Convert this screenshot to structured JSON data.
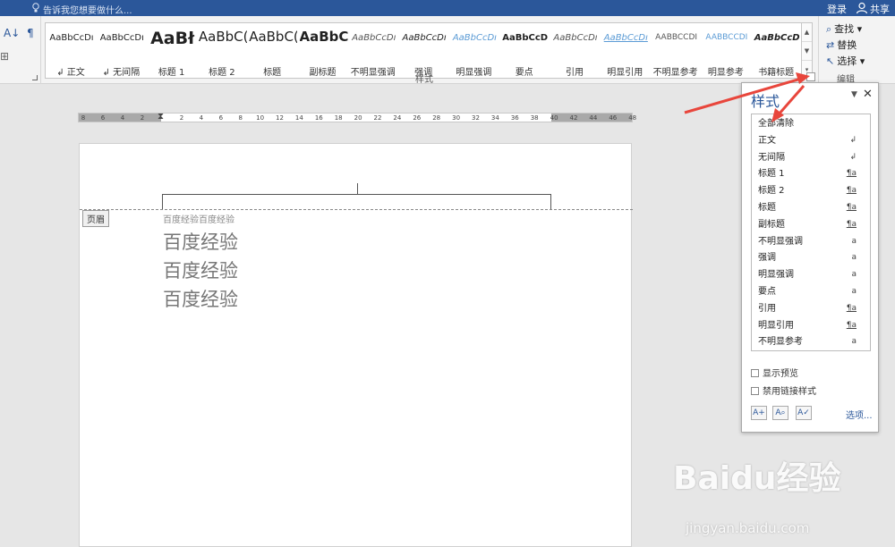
{
  "topbar": {
    "tell_me": "告诉我您想要做什么...",
    "login": "登录",
    "share": "共享"
  },
  "ribbon": {
    "styles_group_label": "样式",
    "editing_group_label": "编辑",
    "find": "查找",
    "replace": "替换",
    "select": "选择",
    "styles": [
      {
        "preview": "AaBbCcDı",
        "name": "↲ 正文"
      },
      {
        "preview": "AaBbCcDı",
        "name": "↲ 无间隔"
      },
      {
        "preview": "AaBł",
        "name": "标题 1"
      },
      {
        "preview": "AaBbC(",
        "name": "标题 2"
      },
      {
        "preview": "AaBbC(",
        "name": "标题"
      },
      {
        "preview": "AaBbC(",
        "name": "副标题"
      },
      {
        "preview": "AaBbCcDı",
        "name": "不明显强调"
      },
      {
        "preview": "AaBbCcDı",
        "name": "强调"
      },
      {
        "preview": "AaBbCcDı",
        "name": "明显强调"
      },
      {
        "preview": "AaBbCcD",
        "name": "要点"
      },
      {
        "preview": "AaBbCcDı",
        "name": "引用"
      },
      {
        "preview": "AaBbCcDı",
        "name": "明显引用"
      },
      {
        "preview": "AABBCCDI",
        "name": "不明显参考"
      },
      {
        "preview": "AABBCCDI",
        "name": "明显参考"
      },
      {
        "preview": "AaBbCcD",
        "name": "书籍标题"
      }
    ]
  },
  "ruler": {
    "ticks": [
      "8",
      "6",
      "4",
      "2",
      "2",
      "4",
      "6",
      "8",
      "10",
      "12",
      "14",
      "16",
      "18",
      "20",
      "22",
      "24",
      "26",
      "28",
      "30",
      "32",
      "34",
      "36",
      "38",
      "40",
      "42",
      "44",
      "46",
      "48"
    ]
  },
  "document": {
    "header_tag": "页眉",
    "header_text": "百度经验百度经验",
    "lines": [
      "百度经验",
      "百度经验",
      "百度经验"
    ]
  },
  "pane": {
    "title": "样式",
    "items": [
      {
        "label": "全部清除",
        "indicator": ""
      },
      {
        "label": "正文",
        "indicator": "↲"
      },
      {
        "label": "无间隔",
        "indicator": "↲"
      },
      {
        "label": "标题 1",
        "indicator": "¶a"
      },
      {
        "label": "标题 2",
        "indicator": "¶a"
      },
      {
        "label": "标题",
        "indicator": "¶a"
      },
      {
        "label": "副标题",
        "indicator": "¶a"
      },
      {
        "label": "不明显强调",
        "indicator": "a"
      },
      {
        "label": "强调",
        "indicator": "a"
      },
      {
        "label": "明显强调",
        "indicator": "a"
      },
      {
        "label": "要点",
        "indicator": "a"
      },
      {
        "label": "引用",
        "indicator": "¶a"
      },
      {
        "label": "明显引用",
        "indicator": "¶a"
      },
      {
        "label": "不明显参考",
        "indicator": "a"
      }
    ],
    "show_preview": "显示预览",
    "disable_linked": "禁用链接样式",
    "options": "选项..."
  },
  "watermark": {
    "brand": "Baidu经验",
    "url": "jingyan.baidu.com"
  },
  "colors": {
    "accent": "#2b579a",
    "annotation": "#e8463c"
  }
}
